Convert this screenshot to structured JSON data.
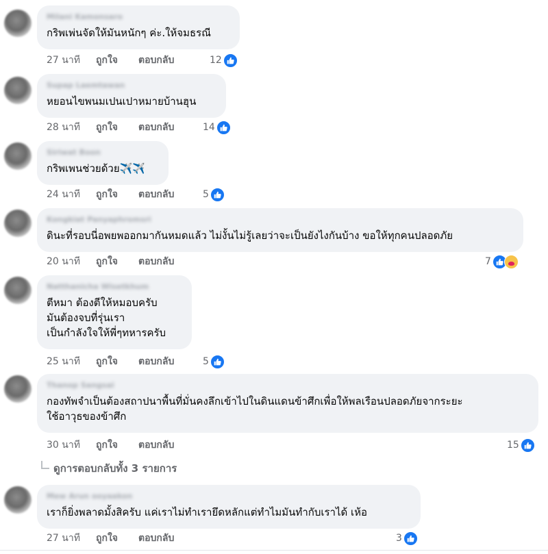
{
  "comments": [
    {
      "author": "Milani Kamonsaro",
      "lines": [
        "กริพเพ่นจัดให้มันหนักๆ ค่ะ.ให้จมธรณี"
      ],
      "time": "27 นาที",
      "like": "ถูกใจ",
      "reply": "ตอบกลับ",
      "reactions": "12"
    },
    {
      "author": "Supap Laemtawan",
      "lines": [
        "หยอนไขพนมเปนเปาหมายบ้านฮุน"
      ],
      "time": "28 นาที",
      "like": "ถูกใจ",
      "reply": "ตอบกลับ",
      "reactions": "14"
    },
    {
      "author": "Siriwat Boon",
      "lines": [
        "กริพเพนช่วยด้วย✈️✈️"
      ],
      "time": "24 นาที",
      "like": "ถูกใจ",
      "reply": "ตอบกลับ",
      "reactions": "5"
    },
    {
      "author": "Kongkiat Panyaphromsri",
      "lines": [
        "ดินะที่รอบนี่อพยพออกมากันหมดแล้ว ไม่งั้นไม่รู้เลยว่าจะเป็นยังไงกันบ้าง ขอให้ทุกคนปลอดภัย"
      ],
      "time": "20 นาที",
      "like": "ถูกใจ",
      "reply": "ตอบกลับ",
      "reactions": "7"
    },
    {
      "author": "Natthanicha Wisetkhum",
      "lines": [
        "ตีหมา ต้องตีให้หมอบครับ",
        "มันต้องจบที่รุ่นเรา",
        "เป็นกำลังใจให้พี่ๆทหารครับ"
      ],
      "time": "25 นาที",
      "like": "ถูกใจ",
      "reply": "ตอบกลับ",
      "reactions": "5"
    },
    {
      "author": "Thanop Sangsai",
      "lines": [
        "กองทัพจำเป็นต้องสถาปนาพื้นที่มั่นคงลึกเข้าไปในดินแดนข้าศึกเพื่อให้พลเรือนปลอดภัยจากระยะ",
        "ใช้อาวุธของข้าศึก"
      ],
      "time": "30 นาที",
      "like": "ถูกใจ",
      "reply": "ตอบกลับ",
      "reactions": "15"
    },
    {
      "author": "Mew Arun ooyaakon",
      "lines": [
        "เราก็ยิ่งพลาดมั้งสิครับ แค่เราไม่ทำเรายึดหลักแต่ทำไมมันทำกับเราได้ เห้อ"
      ],
      "time": "27 นาที",
      "like": "ถูกใจ",
      "reply": "ตอบกลับ",
      "reactions": "3"
    }
  ],
  "view_replies": "ดูการตอบกลับทั้ง 3 รายการ",
  "colors": {
    "like_blue": "#1877f2",
    "bubble_bg": "#f0f2f5",
    "meta_gray": "#65676b"
  }
}
